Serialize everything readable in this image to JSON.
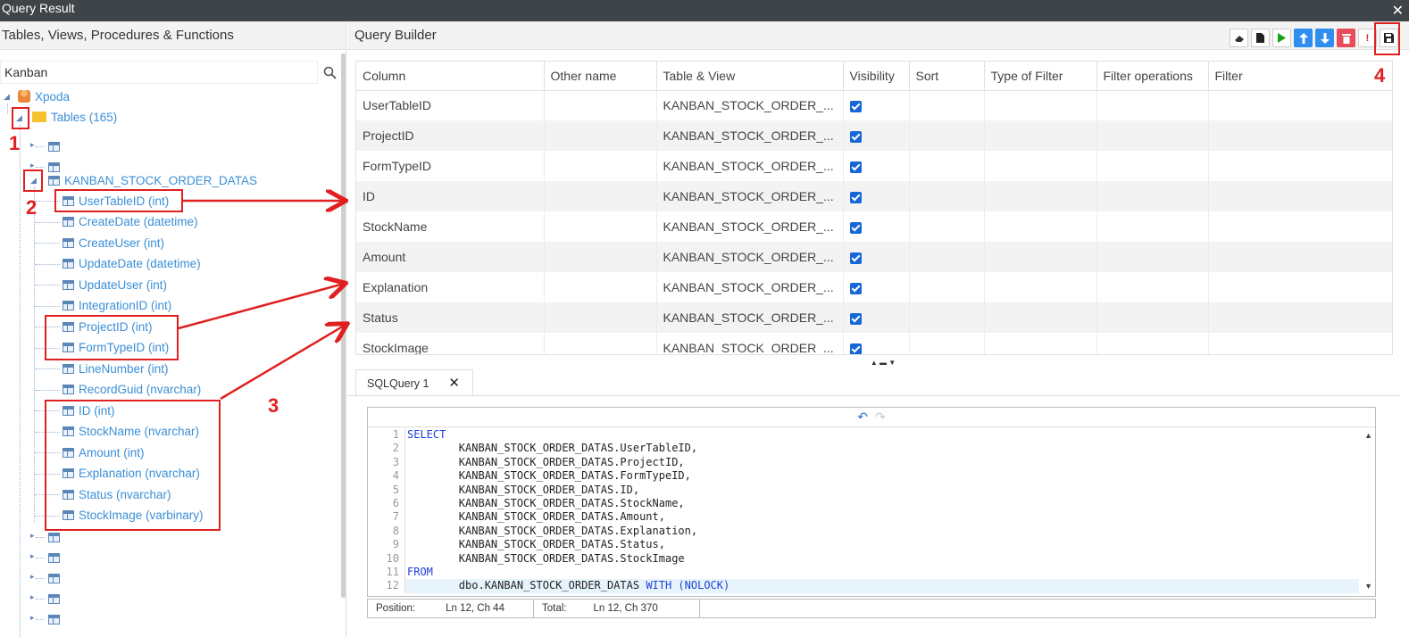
{
  "window": {
    "title": "Query Result",
    "close_glyph": "✕"
  },
  "left_panel": {
    "header": "Tables, Views, Procedures & Functions",
    "search": {
      "value": "Kanban"
    },
    "root": "Xpoda",
    "tables_node": "Tables (165)",
    "table_name": "KANBAN_STOCK_ORDER_DATAS",
    "columns": [
      "UserTableID (int)",
      "CreateDate (datetime)",
      "CreateUser (int)",
      "UpdateDate (datetime)",
      "UpdateUser (int)",
      "IntegrationID (int)",
      "ProjectID (int)",
      "FormTypeID (int)",
      "LineNumber (int)",
      "RecordGuid (nvarchar)",
      "ID (int)",
      "StockName (nvarchar)",
      "Amount (int)",
      "Explanation (nvarchar)",
      "Status (nvarchar)",
      "StockImage (varbinary)"
    ]
  },
  "query_builder": {
    "header": "Query Builder",
    "toolbar": [
      "eraser-icon",
      "new-document-icon",
      "run-icon",
      "move-up-icon",
      "move-down-icon",
      "delete-icon",
      "warning-icon",
      "save-icon"
    ],
    "columns": [
      "Column",
      "Other name",
      "Table & View",
      "Visibility",
      "Sort",
      "Type of Filter",
      "Filter operations",
      "Filter"
    ],
    "rows": [
      {
        "column": "UserTableID",
        "table": "KANBAN_STOCK_ORDER_...",
        "visible": true
      },
      {
        "column": "ProjectID",
        "table": "KANBAN_STOCK_ORDER_...",
        "visible": true
      },
      {
        "column": "FormTypeID",
        "table": "KANBAN_STOCK_ORDER_...",
        "visible": true
      },
      {
        "column": "ID",
        "table": "KANBAN_STOCK_ORDER_...",
        "visible": true
      },
      {
        "column": "StockName",
        "table": "KANBAN_STOCK_ORDER_...",
        "visible": true
      },
      {
        "column": "Amount",
        "table": "KANBAN_STOCK_ORDER_...",
        "visible": true
      },
      {
        "column": "Explanation",
        "table": "KANBAN_STOCK_ORDER_...",
        "visible": true
      },
      {
        "column": "Status",
        "table": "KANBAN_STOCK_ORDER_...",
        "visible": true
      },
      {
        "column": "StockImage",
        "table": "KANBAN_STOCK_ORDER_...",
        "visible": true
      }
    ]
  },
  "sql": {
    "tab_label": "SQLQuery 1",
    "lines": [
      {
        "n": "1",
        "kw": "SELECT",
        "text": ""
      },
      {
        "n": "2",
        "kw": "",
        "text": "        KANBAN_STOCK_ORDER_DATAS.UserTableID,"
      },
      {
        "n": "3",
        "kw": "",
        "text": "        KANBAN_STOCK_ORDER_DATAS.ProjectID,"
      },
      {
        "n": "4",
        "kw": "",
        "text": "        KANBAN_STOCK_ORDER_DATAS.FormTypeID,"
      },
      {
        "n": "5",
        "kw": "",
        "text": "        KANBAN_STOCK_ORDER_DATAS.ID,"
      },
      {
        "n": "6",
        "kw": "",
        "text": "        KANBAN_STOCK_ORDER_DATAS.StockName,"
      },
      {
        "n": "7",
        "kw": "",
        "text": "        KANBAN_STOCK_ORDER_DATAS.Amount,"
      },
      {
        "n": "8",
        "kw": "",
        "text": "        KANBAN_STOCK_ORDER_DATAS.Explanation,"
      },
      {
        "n": "9",
        "kw": "",
        "text": "        KANBAN_STOCK_ORDER_DATAS.Status,"
      },
      {
        "n": "10",
        "kw": "",
        "text": "        KANBAN_STOCK_ORDER_DATAS.StockImage"
      },
      {
        "n": "11",
        "kw": "FROM",
        "text": ""
      },
      {
        "n": "12",
        "kw": "",
        "text": "        dbo.KANBAN_STOCK_ORDER_DATAS ",
        "kw2": "WITH (NOLOCK)"
      }
    ],
    "status": {
      "position_label": "Position:",
      "position_value": "Ln 12, Ch 44",
      "total_label": "Total:",
      "total_value": "Ln 12, Ch 370"
    }
  },
  "annotations": [
    "1",
    "2",
    "3",
    "4"
  ],
  "colors": {
    "annotation": "#e02020",
    "link": "#3a8fd6",
    "titlebar": "#3f4448"
  }
}
